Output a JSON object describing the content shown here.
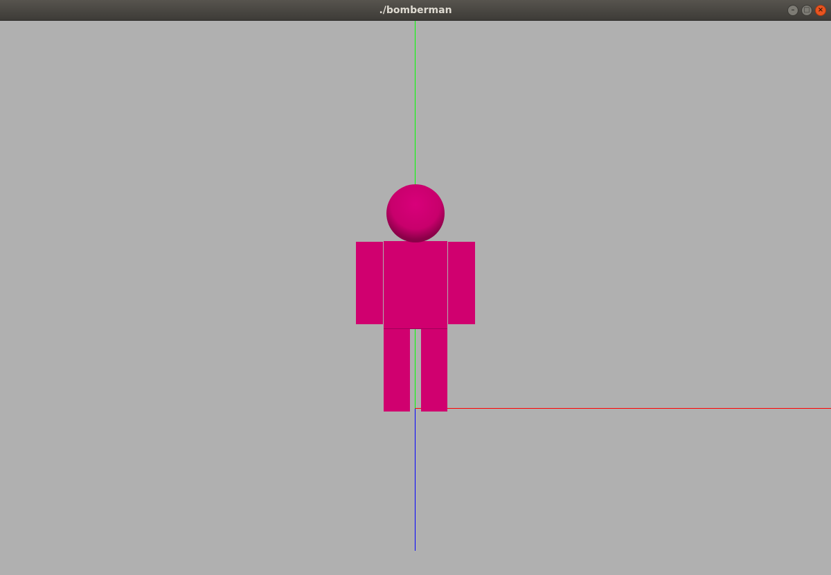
{
  "window": {
    "title": "./bomberman",
    "controls": {
      "minimize": "–",
      "maximize": "□",
      "close": "×"
    }
  },
  "scene": {
    "background_color": "#b0b0b0",
    "axes": {
      "x_color": "#ff0000",
      "y_color": "#00ff00",
      "z_color": "#0000ff"
    },
    "player": {
      "color": "#d0006f"
    }
  }
}
